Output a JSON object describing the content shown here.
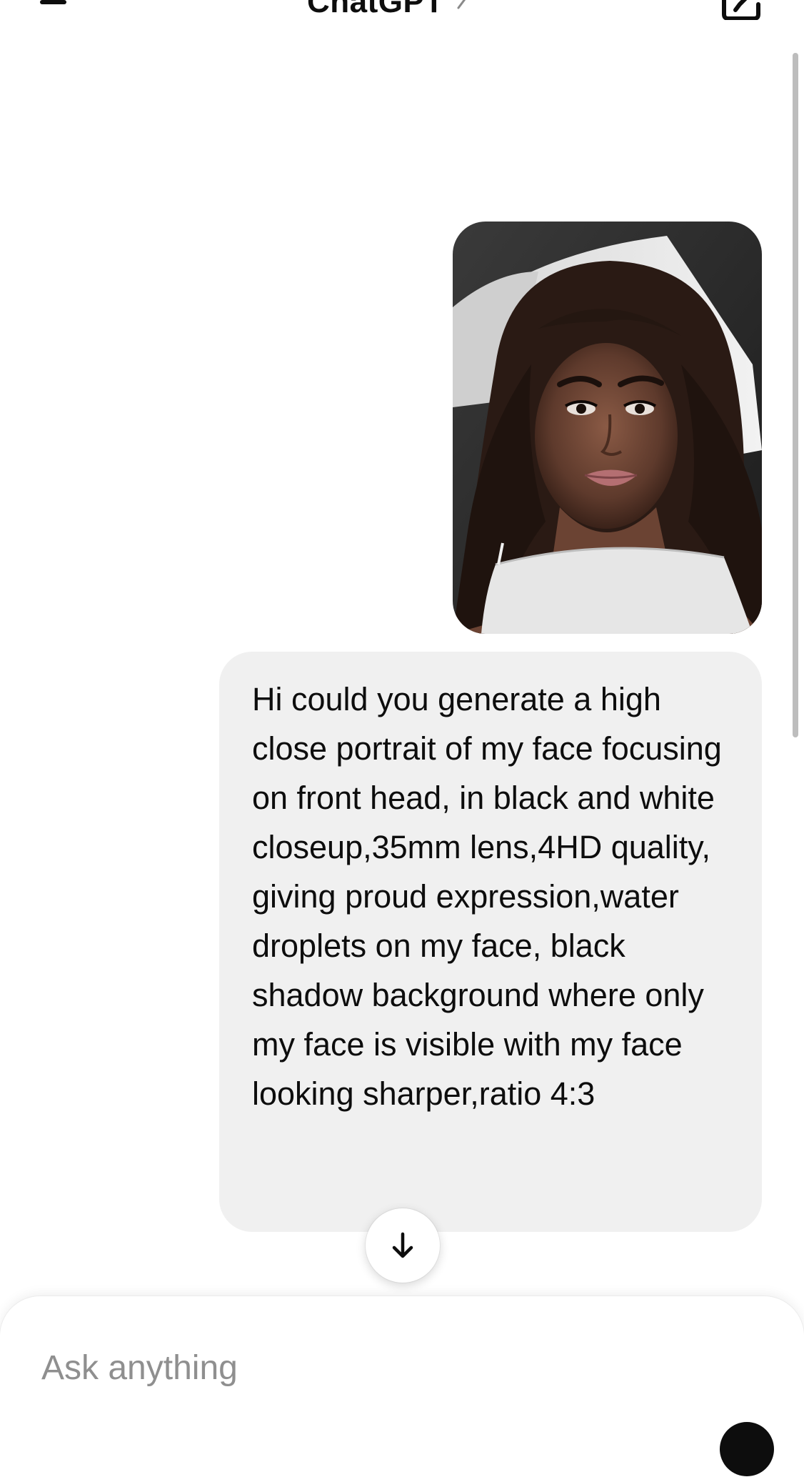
{
  "header": {
    "title": "ChatGPT",
    "menu_icon": "hamburger-menu-icon",
    "title_chevron_icon": "chevron-right-icon",
    "compose_icon": "new-chat-edit-icon"
  },
  "conversation": {
    "user_message": {
      "attachment": {
        "type": "photo",
        "description_icon": "photo-attachment"
      },
      "text": "Hi could you generate a high close portrait of my face focusing on front head, in black and white closeup,35mm lens,4HD quality, giving proud expression,water droplets on my face, black shadow background where only my face is visible with my face looking sharper,ratio 4:3"
    },
    "scroll_down_icon": "arrow-down-icon"
  },
  "composer": {
    "placeholder": "Ask anything",
    "value": "",
    "voice_icon": "voice-mode-icon"
  },
  "colors": {
    "background": "#ffffff",
    "bubble": "#f0f0f0",
    "text": "#0d0d0d",
    "placeholder": "#8f8f8f"
  }
}
